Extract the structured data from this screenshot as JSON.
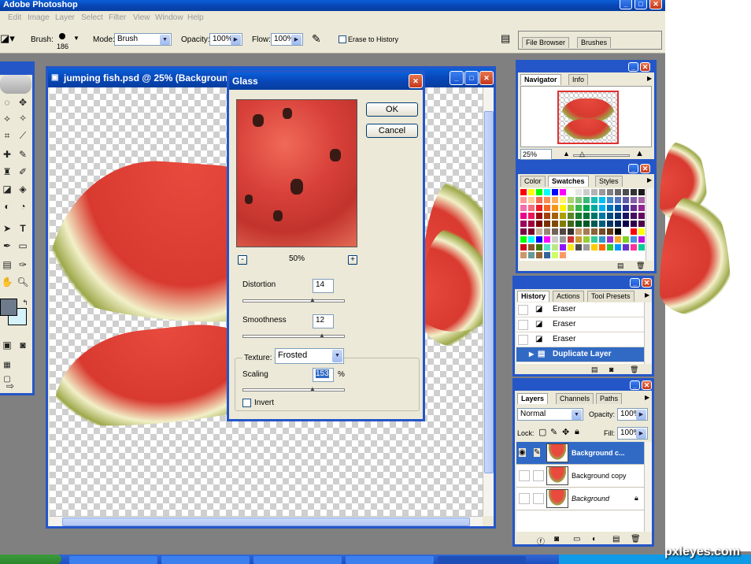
{
  "app": {
    "title": "Adobe Photoshop"
  },
  "menu": [
    "Edit",
    "Image",
    "Layer",
    "Select",
    "Filter",
    "View",
    "Window",
    "Help"
  ],
  "options_bar": {
    "brush_label": "Brush:",
    "brush_size": "186",
    "mode_label": "Mode:",
    "mode_value": "Brush",
    "opacity_label": "Opacity:",
    "opacity_value": "100%",
    "flow_label": "Flow:",
    "flow_value": "100%",
    "erase_to_history": "Erase to History",
    "well_tabs": [
      "File Browser",
      "Brushes"
    ]
  },
  "document": {
    "title": "jumping fish.psd @ 25% (Background co"
  },
  "glass_dialog": {
    "title": "Glass",
    "ok": "OK",
    "cancel": "Cancel",
    "zoom": "50%",
    "zoom_out": "-",
    "zoom_in": "+",
    "distortion_label": "Distortion",
    "distortion_value": "14",
    "distortion_fraction": 0.7,
    "smoothness_label": "Smoothness",
    "smoothness_value": "12",
    "smoothness_fraction": 0.8,
    "texture_label": "Texture:",
    "texture_value": "Frosted",
    "scaling_label": "Scaling",
    "scaling_value": "153",
    "scaling_unit": "%",
    "scaling_fraction": 0.7,
    "invert_label": "Invert"
  },
  "navigator": {
    "tabs": [
      "Navigator",
      "Info"
    ],
    "zoom": "25%"
  },
  "swatches": {
    "tabs": [
      "Color",
      "Swatches",
      "Styles"
    ],
    "colors": [
      "#ff0000",
      "#ffff00",
      "#00ff00",
      "#00ffff",
      "#0000ff",
      "#ff00ff",
      "#ffffff",
      "#e6e6e6",
      "#cccccc",
      "#b3b3b3",
      "#999999",
      "#808080",
      "#666666",
      "#4d4d4d",
      "#333333",
      "#1a1a1a",
      "#ff9999",
      "#ffcc99",
      "#f26c4f",
      "#f68e55",
      "#fbaf5d",
      "#fff467",
      "#acd372",
      "#7cc576",
      "#3bb878",
      "#1abbb4",
      "#00bff3",
      "#438ccb",
      "#5574b9",
      "#605ca8",
      "#855fa8",
      "#a763a8",
      "#f06ea9",
      "#f26d7d",
      "#ed1c24",
      "#f26522",
      "#f7941d",
      "#fff200",
      "#8dc63f",
      "#39b54a",
      "#00a651",
      "#00a99d",
      "#00aeef",
      "#0072bc",
      "#0054a6",
      "#2e3192",
      "#662d91",
      "#92278f",
      "#ec008c",
      "#ed145b",
      "#9e0b0f",
      "#a0410d",
      "#a36209",
      "#aba000",
      "#598527",
      "#1a7b30",
      "#007236",
      "#00746b",
      "#0076a3",
      "#004a80",
      "#003471",
      "#1b1464",
      "#440e62",
      "#630460",
      "#9e005d",
      "#9e0039",
      "#790000",
      "#7b2e00",
      "#7d4900",
      "#827b00",
      "#406618",
      "#005e20",
      "#005826",
      "#005952",
      "#005b7f",
      "#003663",
      "#002157",
      "#0d004c",
      "#32004b",
      "#4b0049",
      "#7b0046",
      "#7a0026",
      "#c7b299",
      "#998675",
      "#736357",
      "#534741",
      "#37302d",
      "#c69c6d",
      "#a67c52",
      "#8c6239",
      "#754c24",
      "#603913",
      "#000000",
      "#ffffff",
      "#ff0000",
      "#ffff00",
      "#00ff00",
      "#00ffff",
      "#0000ff",
      "#ff00ff",
      "#cccccc",
      "#999999",
      "#cc3333",
      "#cc9933",
      "#99cc33",
      "#33cc99",
      "#3399cc",
      "#9933cc",
      "#f5a623",
      "#7ed321",
      "#4a90e2",
      "#bd10e0",
      "#d0021b",
      "#8b572a",
      "#417505",
      "#50e3c2",
      "#b8e986",
      "#9013fe",
      "#f8e71c",
      "#4a4a4a",
      "#9b9b9b",
      "#ffcc00",
      "#ff6600",
      "#33cc33",
      "#0099ff",
      "#6633cc",
      "#ff3399",
      "#00cc99",
      "#cc9966",
      "#669999",
      "#996633",
      "#336699",
      "#ccff66",
      "#ff9966"
    ]
  },
  "history": {
    "tabs": [
      "History",
      "Actions",
      "Tool Presets"
    ],
    "items": [
      "Eraser",
      "Eraser",
      "Eraser",
      "Duplicate Layer"
    ]
  },
  "layers": {
    "tabs": [
      "Layers",
      "Channels",
      "Paths"
    ],
    "blend_mode": "Normal",
    "opacity_label": "Opacity:",
    "opacity_value": "100%",
    "lock_label": "Lock:",
    "fill_label": "Fill:",
    "fill_value": "100%",
    "rows": [
      "Background c...",
      "Background copy",
      "Background"
    ]
  },
  "watermark": "pxleyes.com"
}
